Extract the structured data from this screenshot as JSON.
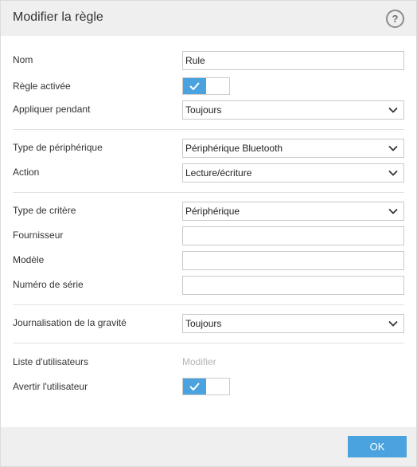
{
  "dialog": {
    "title": "Modifier la règle",
    "help_icon_glyph": "?"
  },
  "fields": {
    "name_label": "Nom",
    "name_value": "Rule",
    "enabled_label": "Règle activée",
    "enabled_on": true,
    "apply_label": "Appliquer pendant",
    "apply_value": "Toujours",
    "device_type_label": "Type de périphérique",
    "device_type_value": "Périphérique Bluetooth",
    "action_label": "Action",
    "action_value": "Lecture/écriture",
    "criteria_type_label": "Type de critère",
    "criteria_type_value": "Périphérique",
    "vendor_label": "Fournisseur",
    "vendor_value": "",
    "model_label": "Modèle",
    "model_value": "",
    "serial_label": "Numéro de série",
    "serial_value": "",
    "logging_label": "Journalisation de la gravité",
    "logging_value": "Toujours",
    "user_list_label": "Liste d'utilisateurs",
    "user_list_link": "Modifier",
    "notify_label": "Avertir l'utilisateur",
    "notify_on": true
  },
  "footer": {
    "ok_label": "OK"
  },
  "colors": {
    "accent": "#4aa3df",
    "title_bar": "#efefef",
    "disabled_text": "#b5b5b5"
  }
}
